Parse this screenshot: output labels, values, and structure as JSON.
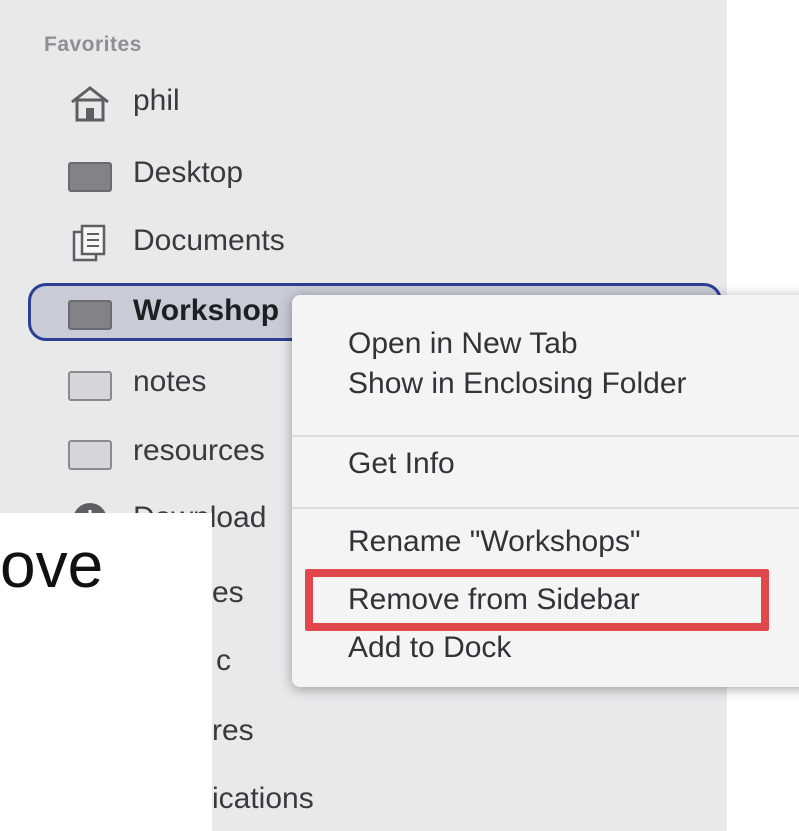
{
  "sidebar": {
    "section_header": "Favorites",
    "items": [
      {
        "label": "phil",
        "icon": "home-icon"
      },
      {
        "label": "Desktop",
        "icon": "desktop-folder-icon"
      },
      {
        "label": "Documents",
        "icon": "documents-icon"
      },
      {
        "label": "Workshop",
        "icon": "folder-icon",
        "selected": true
      },
      {
        "label": "notes",
        "icon": "folder-icon"
      },
      {
        "label": "resources",
        "icon": "folder-icon"
      },
      {
        "label": "Download",
        "icon": "downloads-icon"
      },
      {
        "label": "es",
        "icon": "folder-icon"
      },
      {
        "label": "c",
        "icon": "folder-icon"
      },
      {
        "label": "res",
        "icon": "folder-icon"
      },
      {
        "label": "ications",
        "icon": "applications-icon"
      }
    ]
  },
  "context_menu": {
    "items": [
      "Open in New Tab",
      "Show in Enclosing Folder",
      "Get Info",
      "Rename \"Workshops\"",
      "Remove from Sidebar",
      "Add to Dock"
    ],
    "highlighted_item": "Remove from Sidebar",
    "highlight_color": "#e0484c"
  },
  "caption": {
    "text": "ove"
  }
}
